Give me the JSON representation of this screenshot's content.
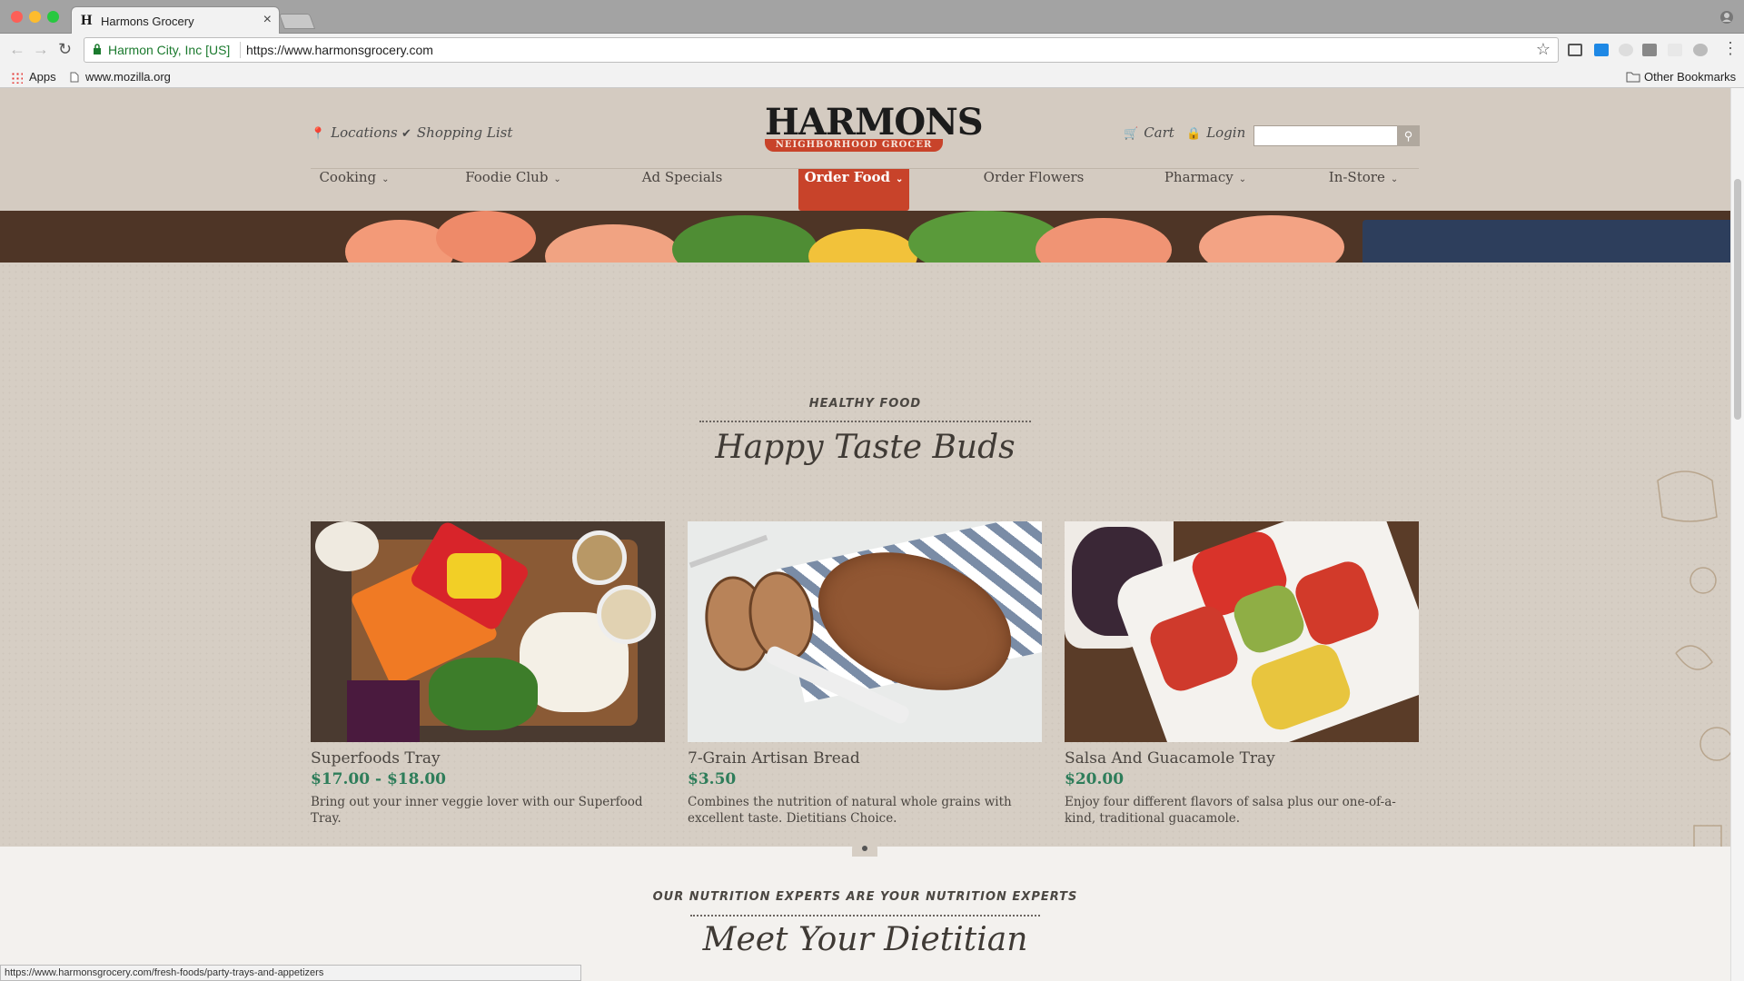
{
  "browser": {
    "tab_title": "Harmons Grocery",
    "tab_favicon": "H",
    "org_label": "Harmon City, Inc [US]",
    "url": "https://www.harmonsgrocery.com",
    "bookmarks": [
      "Apps",
      "www.mozilla.org"
    ],
    "other_bookmarks": "Other Bookmarks",
    "status_url": "https://www.harmonsgrocery.com/fresh-foods/party-trays-and-appetizers"
  },
  "header": {
    "locations": "Locations",
    "shopping_list": "Shopping List",
    "logo_main": "HARMONS",
    "logo_sub": "NEIGHBORHOOD GROCER",
    "cart": "Cart",
    "login": "Login",
    "search_placeholder": ""
  },
  "nav": [
    {
      "label": "Cooking",
      "dropdown": true
    },
    {
      "label": "Foodie Club",
      "dropdown": true
    },
    {
      "label": "Ad Specials",
      "dropdown": false
    },
    {
      "label": "Order Food",
      "dropdown": true,
      "active": true
    },
    {
      "label": "Order Flowers",
      "dropdown": false
    },
    {
      "label": "Pharmacy",
      "dropdown": true
    },
    {
      "label": "In-Store",
      "dropdown": true
    }
  ],
  "section": {
    "eyebrow": "HEALTHY FOOD",
    "title": "Happy Taste Buds"
  },
  "products": [
    {
      "name": "Superfoods Tray",
      "price": "$17.00 - $18.00",
      "desc": "Bring out your inner veggie lover with our Superfood Tray."
    },
    {
      "name": "7-Grain Artisan Bread",
      "price": "$3.50",
      "desc": "Combines the nutrition of natural whole grains with excellent taste. Dietitians Choice."
    },
    {
      "name": "Salsa And Guacamole Tray",
      "price": "$20.00",
      "desc": "Enjoy four different flavors of salsa plus our one-of-a-kind, traditional guacamole."
    }
  ],
  "lower": {
    "eyebrow": "OUR NUTRITION EXPERTS ARE YOUR NUTRITION EXPERTS",
    "title": "Meet Your Dietitian"
  },
  "colors": {
    "accent": "#c8432a",
    "price": "#2e7d5a"
  }
}
